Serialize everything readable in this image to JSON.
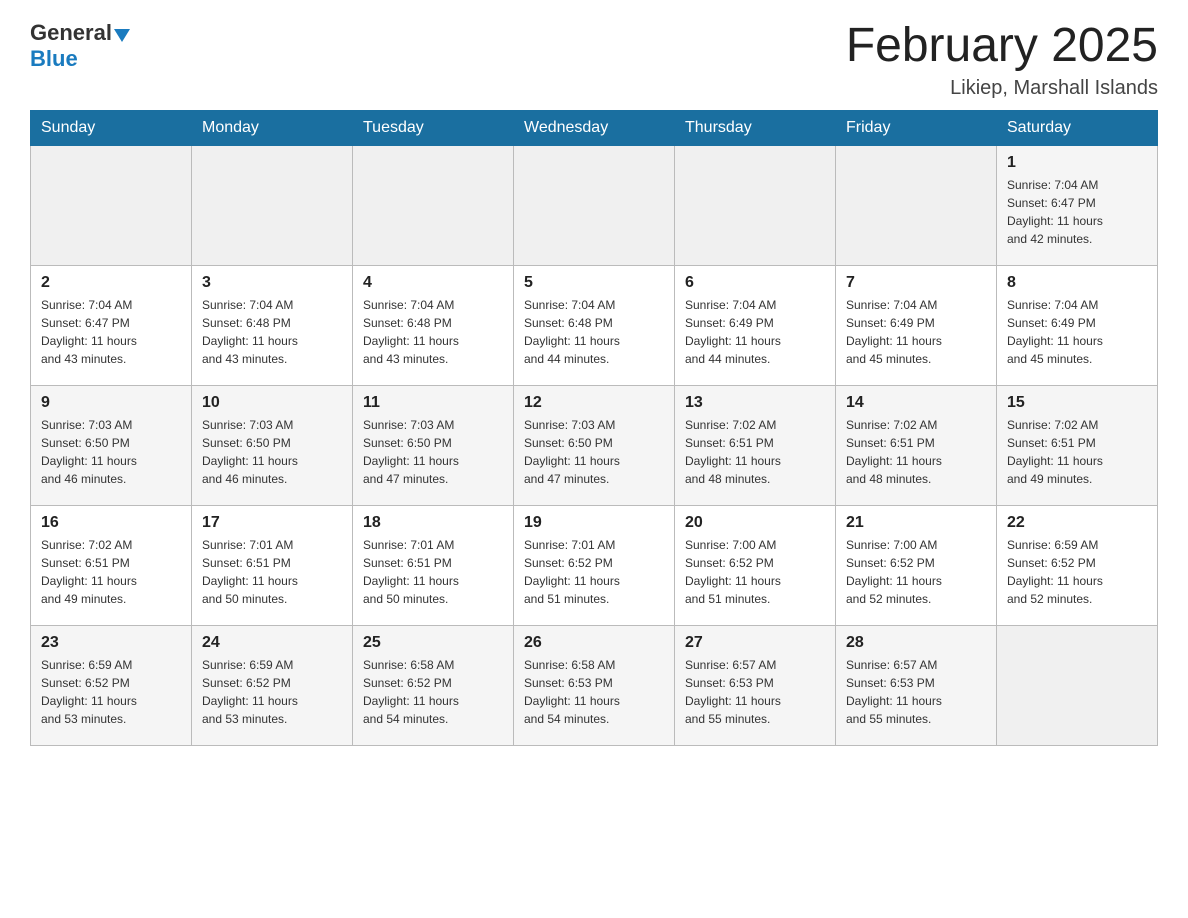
{
  "header": {
    "logo_general": "General",
    "logo_blue": "Blue",
    "month_title": "February 2025",
    "location": "Likiep, Marshall Islands"
  },
  "days_of_week": [
    "Sunday",
    "Monday",
    "Tuesday",
    "Wednesday",
    "Thursday",
    "Friday",
    "Saturday"
  ],
  "weeks": [
    [
      {
        "day": "",
        "info": ""
      },
      {
        "day": "",
        "info": ""
      },
      {
        "day": "",
        "info": ""
      },
      {
        "day": "",
        "info": ""
      },
      {
        "day": "",
        "info": ""
      },
      {
        "day": "",
        "info": ""
      },
      {
        "day": "1",
        "info": "Sunrise: 7:04 AM\nSunset: 6:47 PM\nDaylight: 11 hours\nand 42 minutes."
      }
    ],
    [
      {
        "day": "2",
        "info": "Sunrise: 7:04 AM\nSunset: 6:47 PM\nDaylight: 11 hours\nand 43 minutes."
      },
      {
        "day": "3",
        "info": "Sunrise: 7:04 AM\nSunset: 6:48 PM\nDaylight: 11 hours\nand 43 minutes."
      },
      {
        "day": "4",
        "info": "Sunrise: 7:04 AM\nSunset: 6:48 PM\nDaylight: 11 hours\nand 43 minutes."
      },
      {
        "day": "5",
        "info": "Sunrise: 7:04 AM\nSunset: 6:48 PM\nDaylight: 11 hours\nand 44 minutes."
      },
      {
        "day": "6",
        "info": "Sunrise: 7:04 AM\nSunset: 6:49 PM\nDaylight: 11 hours\nand 44 minutes."
      },
      {
        "day": "7",
        "info": "Sunrise: 7:04 AM\nSunset: 6:49 PM\nDaylight: 11 hours\nand 45 minutes."
      },
      {
        "day": "8",
        "info": "Sunrise: 7:04 AM\nSunset: 6:49 PM\nDaylight: 11 hours\nand 45 minutes."
      }
    ],
    [
      {
        "day": "9",
        "info": "Sunrise: 7:03 AM\nSunset: 6:50 PM\nDaylight: 11 hours\nand 46 minutes."
      },
      {
        "day": "10",
        "info": "Sunrise: 7:03 AM\nSunset: 6:50 PM\nDaylight: 11 hours\nand 46 minutes."
      },
      {
        "day": "11",
        "info": "Sunrise: 7:03 AM\nSunset: 6:50 PM\nDaylight: 11 hours\nand 47 minutes."
      },
      {
        "day": "12",
        "info": "Sunrise: 7:03 AM\nSunset: 6:50 PM\nDaylight: 11 hours\nand 47 minutes."
      },
      {
        "day": "13",
        "info": "Sunrise: 7:02 AM\nSunset: 6:51 PM\nDaylight: 11 hours\nand 48 minutes."
      },
      {
        "day": "14",
        "info": "Sunrise: 7:02 AM\nSunset: 6:51 PM\nDaylight: 11 hours\nand 48 minutes."
      },
      {
        "day": "15",
        "info": "Sunrise: 7:02 AM\nSunset: 6:51 PM\nDaylight: 11 hours\nand 49 minutes."
      }
    ],
    [
      {
        "day": "16",
        "info": "Sunrise: 7:02 AM\nSunset: 6:51 PM\nDaylight: 11 hours\nand 49 minutes."
      },
      {
        "day": "17",
        "info": "Sunrise: 7:01 AM\nSunset: 6:51 PM\nDaylight: 11 hours\nand 50 minutes."
      },
      {
        "day": "18",
        "info": "Sunrise: 7:01 AM\nSunset: 6:51 PM\nDaylight: 11 hours\nand 50 minutes."
      },
      {
        "day": "19",
        "info": "Sunrise: 7:01 AM\nSunset: 6:52 PM\nDaylight: 11 hours\nand 51 minutes."
      },
      {
        "day": "20",
        "info": "Sunrise: 7:00 AM\nSunset: 6:52 PM\nDaylight: 11 hours\nand 51 minutes."
      },
      {
        "day": "21",
        "info": "Sunrise: 7:00 AM\nSunset: 6:52 PM\nDaylight: 11 hours\nand 52 minutes."
      },
      {
        "day": "22",
        "info": "Sunrise: 6:59 AM\nSunset: 6:52 PM\nDaylight: 11 hours\nand 52 minutes."
      }
    ],
    [
      {
        "day": "23",
        "info": "Sunrise: 6:59 AM\nSunset: 6:52 PM\nDaylight: 11 hours\nand 53 minutes."
      },
      {
        "day": "24",
        "info": "Sunrise: 6:59 AM\nSunset: 6:52 PM\nDaylight: 11 hours\nand 53 minutes."
      },
      {
        "day": "25",
        "info": "Sunrise: 6:58 AM\nSunset: 6:52 PM\nDaylight: 11 hours\nand 54 minutes."
      },
      {
        "day": "26",
        "info": "Sunrise: 6:58 AM\nSunset: 6:53 PM\nDaylight: 11 hours\nand 54 minutes."
      },
      {
        "day": "27",
        "info": "Sunrise: 6:57 AM\nSunset: 6:53 PM\nDaylight: 11 hours\nand 55 minutes."
      },
      {
        "day": "28",
        "info": "Sunrise: 6:57 AM\nSunset: 6:53 PM\nDaylight: 11 hours\nand 55 minutes."
      },
      {
        "day": "",
        "info": ""
      }
    ]
  ]
}
